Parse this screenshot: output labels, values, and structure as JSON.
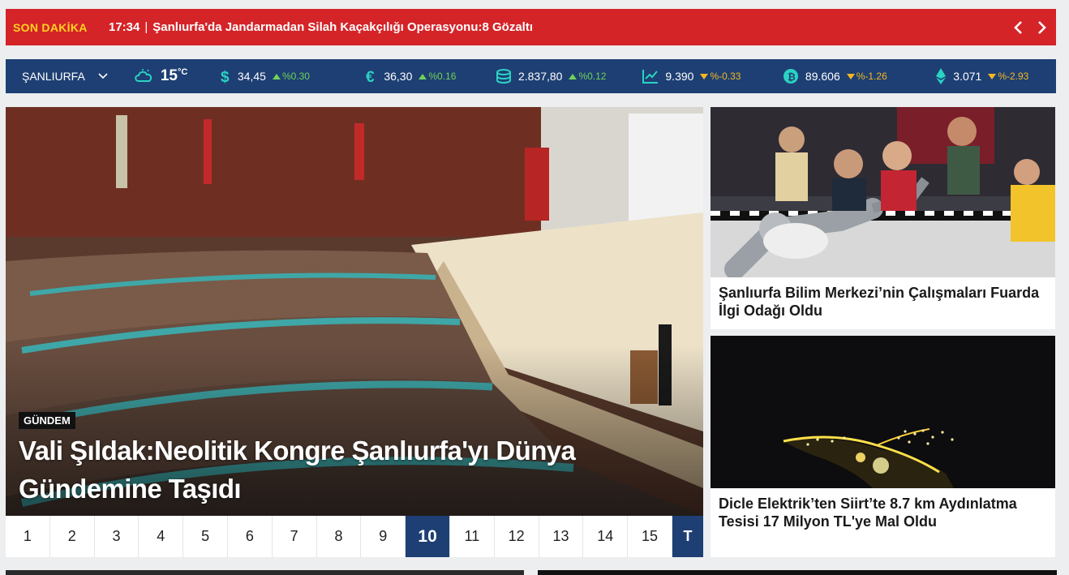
{
  "breaking": {
    "tag": "SON DAKİKA",
    "time": "17:34",
    "separator": "|",
    "headline": "Şanlıurfa'da Jandarmadan Silah Kaçakçılığı Operasyonu:8 Gözaltı"
  },
  "market": {
    "city": "ŞANLIURFA",
    "weather_temp": "15",
    "weather_unit": "°C",
    "items": [
      {
        "icon": "dollar-icon",
        "value": "34,45",
        "change": "%0.30",
        "dir": "up"
      },
      {
        "icon": "euro-icon",
        "value": "36,30",
        "change": "%0.16",
        "dir": "up"
      },
      {
        "icon": "gold-coins-icon",
        "value": "2.837,80",
        "change": "%0.12",
        "dir": "up"
      },
      {
        "icon": "stock-chart-icon",
        "value": "9.390",
        "change": "%-0.33",
        "dir": "down"
      },
      {
        "icon": "bitcoin-icon",
        "value": "89.606",
        "change": "%-1.26",
        "dir": "down"
      },
      {
        "icon": "ethereum-icon",
        "value": "3.071",
        "change": "%-2.93",
        "dir": "down"
      }
    ]
  },
  "hero": {
    "category": "GÜNDEM",
    "title": "Vali Şıldak:Neolitik Kongre Şanlıurfa'yı Dünya Gündemine Taşıdı"
  },
  "pager": {
    "pages": [
      "1",
      "2",
      "3",
      "4",
      "5",
      "6",
      "7",
      "8",
      "9",
      "10",
      "11",
      "12",
      "13",
      "14",
      "15"
    ],
    "active": "10",
    "last": "T"
  },
  "side": [
    {
      "caption": "Şanlıurfa Bilim Merkezi’nin Çalışmaları Fuarda İlgi Odağı Oldu"
    },
    {
      "caption": "Dicle Elektrik’ten Siirt’te 8.7 km Aydınlatma Tesisi 17 Milyon TL'ye Mal Oldu"
    }
  ],
  "colors": {
    "breaking_bg": "#d42428",
    "breaking_tag": "#ffd21f",
    "market_bg": "#1e3f73",
    "accent_teal": "#2ad3c3",
    "up": "#6fd35a",
    "down": "#f5b820"
  }
}
